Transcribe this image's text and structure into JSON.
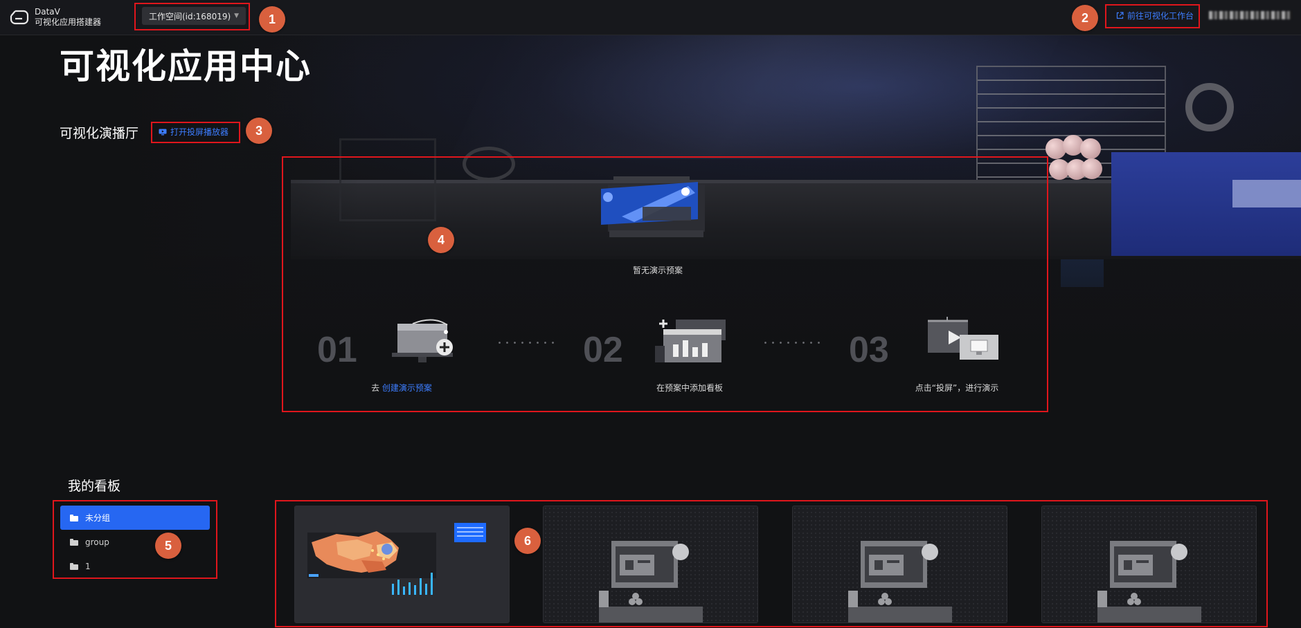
{
  "header": {
    "brand_line1": "DataV",
    "brand_line2": "可视化应用搭建器",
    "workspace_selector": "工作空间(id:168019)",
    "go_workbench_link": "前往可视化工作台"
  },
  "page": {
    "title": "可视化应用中心"
  },
  "hall": {
    "title": "可视化演播厅",
    "open_player_button": "打开投屏播放器",
    "empty_text": "暂无演示预案",
    "steps": [
      {
        "number": "01",
        "prefix": "去 ",
        "link": "创建演示预案",
        "text": ""
      },
      {
        "number": "02",
        "prefix": "",
        "link": "",
        "text": "在预案中添加看板"
      },
      {
        "number": "03",
        "prefix": "",
        "link": "",
        "text": "点击“投屏”，进行演示"
      }
    ]
  },
  "boards": {
    "title": "我的看板",
    "groups": [
      {
        "label": "未分组",
        "active": true
      },
      {
        "label": "group",
        "active": false
      },
      {
        "label": "1",
        "active": false
      }
    ]
  },
  "annotations": [
    "1",
    "2",
    "3",
    "4",
    "5",
    "6"
  ],
  "colors": {
    "accent": "#2667f2",
    "link": "#3d7dff",
    "annotation_box": "#e0161c",
    "annotation_badge": "#d9603e",
    "background": "#111214"
  }
}
